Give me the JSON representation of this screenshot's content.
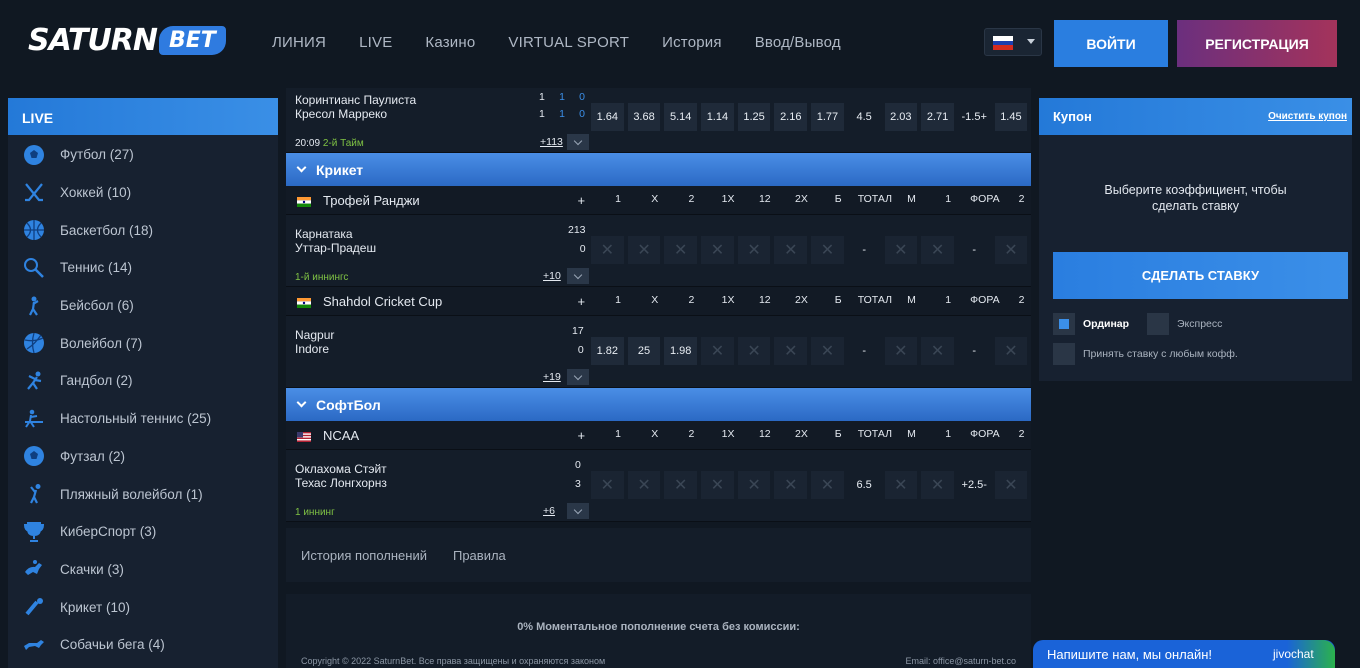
{
  "header": {
    "logo_main": "SATURN",
    "logo_badge": "BET",
    "nav": [
      "ЛИНИЯ",
      "LIVE",
      "Казино",
      "VIRTUAL SPORT",
      "История",
      "Ввод/Вывод"
    ],
    "login": "ВОЙТИ",
    "register": "РЕГИСТРАЦИЯ",
    "lang_flag": "ru"
  },
  "sidebar": {
    "title": "LIVE",
    "items": [
      {
        "label": "Футбол (27)",
        "icon": "football-icon"
      },
      {
        "label": "Хоккей (10)",
        "icon": "hockey-icon"
      },
      {
        "label": "Баскетбол (18)",
        "icon": "basketball-icon"
      },
      {
        "label": "Теннис (14)",
        "icon": "tennis-icon"
      },
      {
        "label": "Бейсбол (6)",
        "icon": "baseball-icon"
      },
      {
        "label": "Волейбол (7)",
        "icon": "volleyball-icon"
      },
      {
        "label": "Гандбол (2)",
        "icon": "handball-icon"
      },
      {
        "label": "Настольный теннис (25)",
        "icon": "table-tennis-icon"
      },
      {
        "label": "Футзал (2)",
        "icon": "futsal-icon"
      },
      {
        "label": "Пляжный волейбол (1)",
        "icon": "beach-volleyball-icon"
      },
      {
        "label": "КиберСпорт (3)",
        "icon": "esports-icon"
      },
      {
        "label": "Скачки (3)",
        "icon": "horse-racing-icon"
      },
      {
        "label": "Крикет (10)",
        "icon": "cricket-icon"
      },
      {
        "label": "Собачьи бега (4)",
        "icon": "dog-racing-icon"
      }
    ]
  },
  "odds_headers": [
    "+",
    "1",
    "X",
    "2",
    "1X",
    "12",
    "2X",
    "Б",
    "ТОТАЛ",
    "М",
    "1",
    "ФОРА",
    "2"
  ],
  "top_match": {
    "team1": "Коринтианс Паулиста",
    "team2": "Кресол Марреко",
    "score1": [
      "1",
      "1",
      "0"
    ],
    "score2": [
      "1",
      "1",
      "0"
    ],
    "time": "20:09",
    "period": "2-й Тайм",
    "more": "+113",
    "odds": [
      "1.64",
      "3.68",
      "5.14",
      "1.14",
      "1.25",
      "2.16",
      "1.77",
      "4.5",
      "2.03",
      "2.71",
      "-1.5+",
      "1.45"
    ]
  },
  "categories": [
    {
      "name": "Крикет",
      "leagues": [
        {
          "name": "Трофей Ранджи",
          "flag": "in",
          "match": {
            "team1": "Карнатака",
            "team2": "Уттар-Прадеш",
            "score1": "213",
            "score2": "0",
            "period": "1-й иннингс",
            "more": "+10",
            "odds": [
              "x",
              "x",
              "x",
              "x",
              "x",
              "x",
              "x",
              "-",
              "x",
              "x",
              "-",
              "x"
            ]
          }
        },
        {
          "name": "Shahdol Cricket Cup",
          "flag": "in",
          "match": {
            "team1": "Nagpur",
            "team2": "Indore",
            "score1": "17",
            "score2": "0",
            "period": "",
            "more": "+19",
            "odds": [
              "1.82",
              "25",
              "1.98",
              "x",
              "x",
              "x",
              "x",
              "-",
              "x",
              "x",
              "-",
              "x"
            ]
          }
        }
      ]
    },
    {
      "name": "СофтБол",
      "leagues": [
        {
          "name": "NCAA",
          "flag": "us",
          "match": {
            "team1": "Оклахома Стэйт",
            "team2": "Техас Лонгхорнз",
            "score1": "0",
            "score2": "3",
            "period": "1 иннинг",
            "more": "+6",
            "odds": [
              "x",
              "x",
              "x",
              "x",
              "x",
              "x",
              "x",
              "6.5",
              "x",
              "x",
              "+2.5-",
              "x"
            ]
          }
        }
      ]
    }
  ],
  "footer": {
    "tabs": [
      "История пополнений",
      "Правила"
    ],
    "promo": "0% Моментальное пополнение счета без комиссии:",
    "copyright": "Copyright © 2022 SaturnBet. Все права защищены и охраняются законом",
    "email": "Email: office@saturn-bet.co"
  },
  "coupon": {
    "title": "Купон",
    "clear": "Очистить купон",
    "message_line1": "Выберите коэффициент, чтобы",
    "message_line2": "сделать ставку",
    "make_bet": "СДЕЛАТЬ СТАВКУ",
    "single": "Ординар",
    "express": "Экспресс",
    "any_odds": "Принять ставку с любым кофф."
  },
  "chat": {
    "text": "Напишите нам, мы онлайн!",
    "brand": "jivochat"
  },
  "colors": {
    "accent_blue": "#2a7ee0",
    "register_gradient": [
      "#6b2f7e",
      "#a4335b"
    ],
    "period_green": "#7fc244"
  }
}
